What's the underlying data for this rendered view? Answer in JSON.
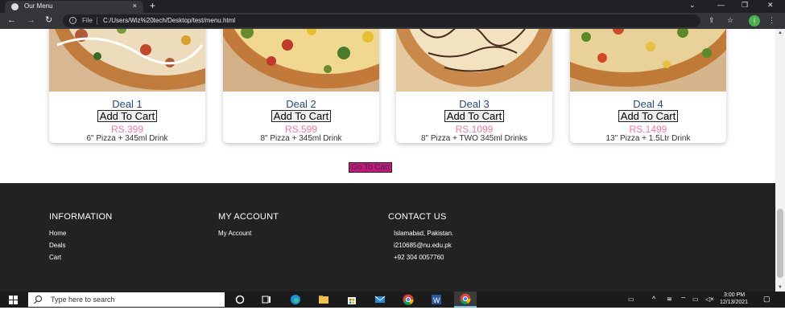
{
  "browser": {
    "tab_title": "Our Menu",
    "tab_close": "×",
    "new_tab": "+",
    "file_label": "File",
    "url": "C:/Users/Wiz%20tech/Desktop/test/menu.html",
    "profile_initial": "i"
  },
  "deals": [
    {
      "name": "Deal 1",
      "button": "Add To Cart",
      "price": "RS.399",
      "desc": "6\" Pizza + 345ml Drink"
    },
    {
      "name": "Deal 2",
      "button": "Add To Cart",
      "price": "RS.599",
      "desc": "8\" Pizza + 345ml Drink"
    },
    {
      "name": "Deal 3",
      "button": "Add To Cart",
      "price": "RS.1099",
      "desc": "8\" Pizza + TWO 345ml Drinks"
    },
    {
      "name": "Deal 4",
      "button": "Add To Cart",
      "price": "RS.1499",
      "desc": "13\" Pizza + 1.5Ltr Drink"
    }
  ],
  "go_to_cart": "Go To Cart",
  "footer": {
    "information": {
      "title": "INFORMATION",
      "links": [
        "Home",
        "Deals",
        "Cart"
      ]
    },
    "account": {
      "title": "MY ACCOUNT",
      "links": [
        "My Account"
      ]
    },
    "contact": {
      "title": "CONTACT US",
      "lines": [
        "Islamabad, Pakistan.",
        "i210685@nu.edu.pk",
        "+92 304 0057760"
      ]
    }
  },
  "taskbar": {
    "search_placeholder": "Type here to search",
    "time": "3:00 PM",
    "date": "12/13/2021"
  },
  "colors": {
    "deal_title": "#2b4a7a",
    "price": "#ee7aa0",
    "go_to_cart_bg": "#c2187f",
    "footer_bg": "#222222"
  }
}
